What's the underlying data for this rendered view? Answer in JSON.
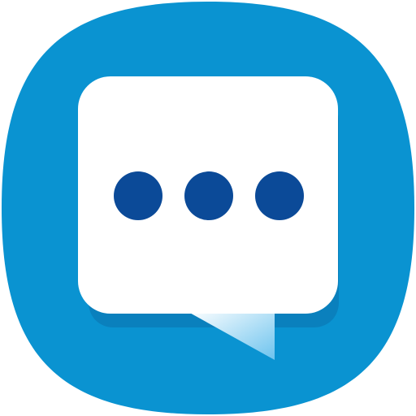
{
  "app_icon": {
    "icon": "chat-bubble-typing-icon",
    "colors": {
      "squircle": "#0a93d1",
      "bubble": "#ffffff",
      "bubble_shadow": "#0a80bd",
      "dots": "#0b4a98",
      "tail_light": "#ffffff",
      "tail_dark": "#6cc3ee"
    },
    "typing_dots_count": 3
  }
}
